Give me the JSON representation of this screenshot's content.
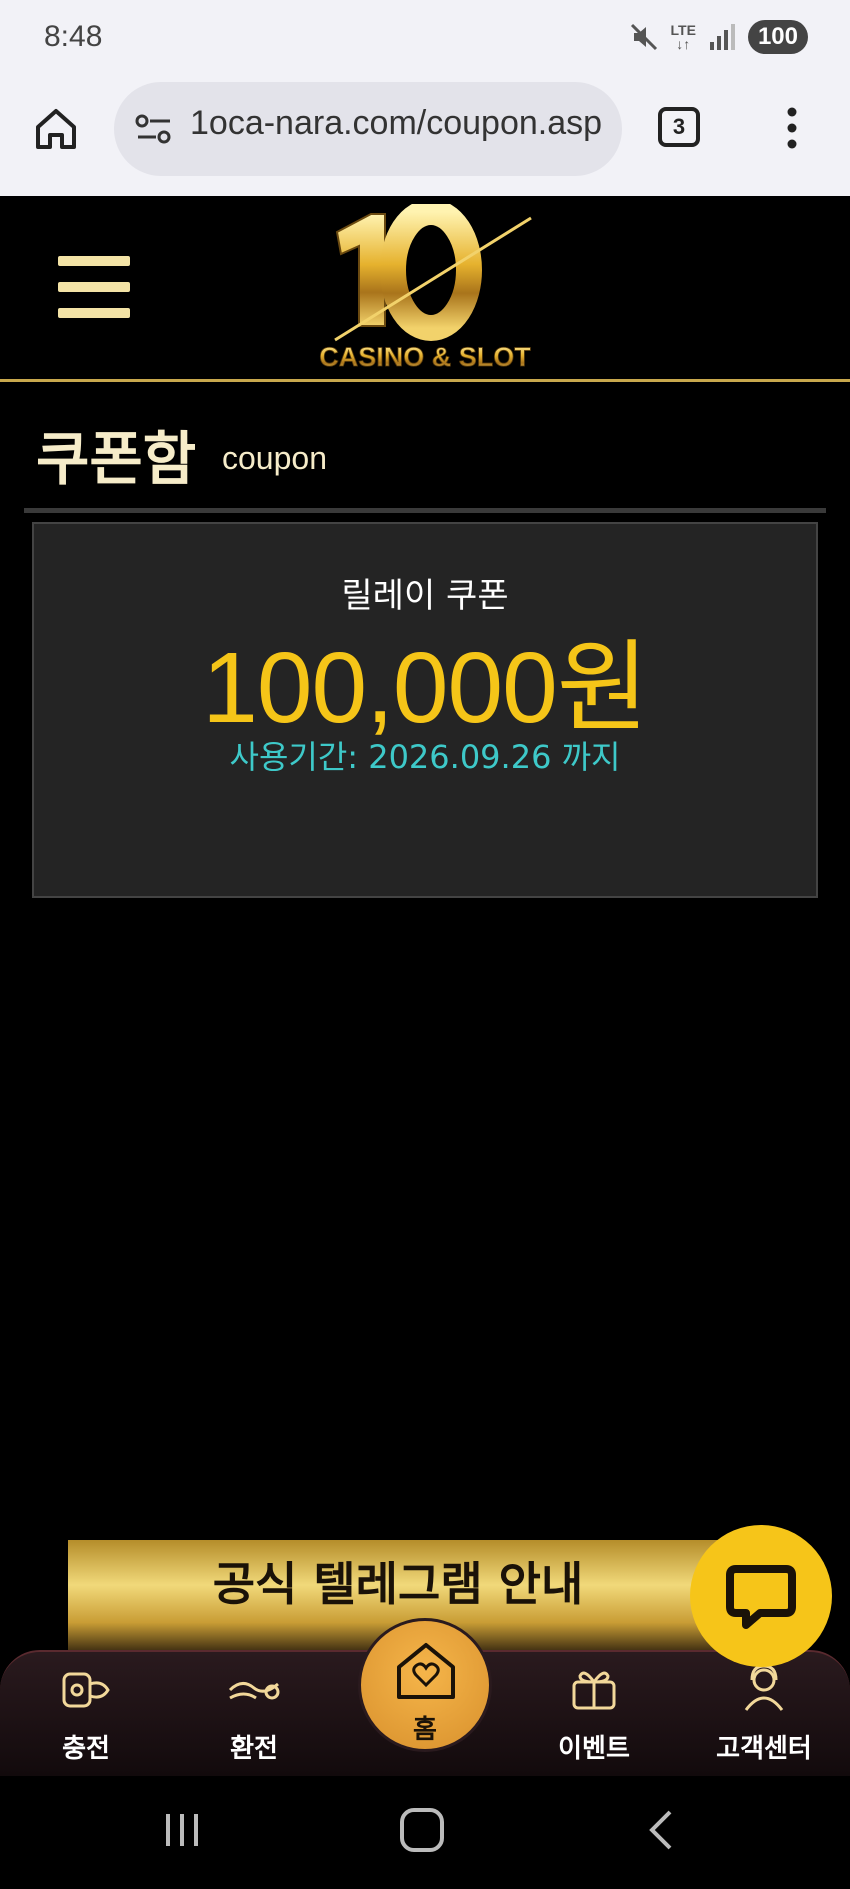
{
  "status_bar": {
    "time": "8:48",
    "network": "LTE",
    "battery": "100"
  },
  "browser": {
    "url": "1oca-nara.com/coupon.asp",
    "tab_count": "3"
  },
  "header": {
    "logo_number": "10",
    "logo_text": "CASINO & SLOT"
  },
  "page": {
    "title": "쿠폰함",
    "subtitle": "coupon"
  },
  "coupon": {
    "name": "릴레이 쿠폰",
    "amount": "100,000원",
    "expiry": "사용기간: 2026.09.26 까지"
  },
  "banner": {
    "text": "공식 텔레그램 안내"
  },
  "bottom_nav": {
    "items": [
      {
        "label": "충전",
        "icon": "deposit-icon"
      },
      {
        "label": "환전",
        "icon": "withdraw-icon"
      },
      {
        "label": "홈",
        "icon": "home-heart-icon"
      },
      {
        "label": "이벤트",
        "icon": "gift-icon"
      },
      {
        "label": "고객센터",
        "icon": "support-icon"
      }
    ]
  },
  "colors": {
    "accent_gold": "#f5c518",
    "expiry_teal": "#3ec9c9",
    "header_line": "#c8a84d"
  }
}
